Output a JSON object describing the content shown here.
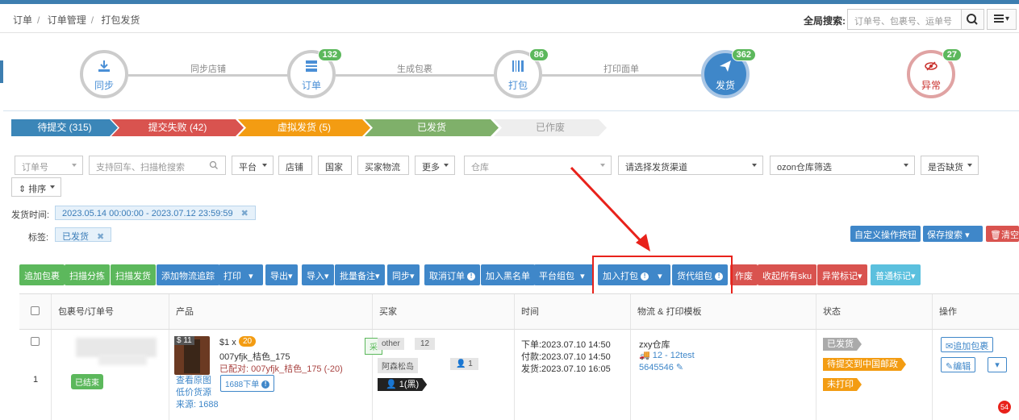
{
  "breadcrumb": [
    "订单",
    "订单管理",
    "打包发货"
  ],
  "search": {
    "label": "全局搜索:",
    "placeholder": "订单号、包裹号、运单号"
  },
  "flow": {
    "nodes": [
      {
        "label": "同步",
        "badge": ""
      },
      {
        "label": "订单",
        "badge": "132"
      },
      {
        "label": "打包",
        "badge": "86"
      },
      {
        "label": "发货",
        "badge": "362"
      },
      {
        "label": "异常",
        "badge": "27"
      }
    ],
    "links": [
      "同步店铺",
      "生成包裹",
      "打印面单"
    ]
  },
  "status_tabs": [
    "待提交 (315)",
    "提交失败 (42)",
    "虚拟发货 (5)",
    "已发货",
    "已作废"
  ],
  "filters": {
    "order_no": "订单号",
    "search_placeholder": "支持回车、扫描枪搜索",
    "platform": "平台",
    "shop": "店铺",
    "country": "国家",
    "buyer_logistics": "买家物流",
    "more": "更多",
    "warehouse": "仓库",
    "channel": "请选择发货渠道",
    "ozon": "ozon仓库筛选",
    "stock": "是否缺货",
    "sort": "排序"
  },
  "ship_time": {
    "label": "发货时间:",
    "value": "2023.05.14 00:00:00 - 2023.07.12 23:59:59"
  },
  "tag": {
    "label": "标签:",
    "value": "已发货"
  },
  "right_buttons": {
    "custom": "自定义操作按钮",
    "save": "保存搜索",
    "clear": "清空"
  },
  "toolbar": [
    "追加包裹",
    "扫描分拣",
    "扫描发货",
    "添加物流追踪",
    "打印",
    "导出",
    "导入",
    "批量备注",
    "同步",
    "取消订单",
    "加入黑名单",
    "平台组包",
    "加入打包",
    "货代组包",
    "作废",
    "收起所有sku",
    "异常标记",
    "普通标记"
  ],
  "table": {
    "headers": [
      "包裹号/订单号",
      "产品",
      "买家",
      "时间",
      "物流 & 打印模板",
      "状态",
      "操作"
    ],
    "row": {
      "index": "1",
      "finished": "已结束",
      "price": "$ 11",
      "qty": "$1 x",
      "qty_badge": "20",
      "sku": "007yfjk_桔色_175",
      "matched": "已配对: 007yfjk_桔色_175 (-20)",
      "purchase_tag": "采",
      "links": [
        "查看原图",
        "低价货源",
        "来源: 1688"
      ],
      "order_1688": "1688下单",
      "buyer_tags": [
        "other",
        "12",
        "阿森松岛",
        "1"
      ],
      "buyer_black": "1(黑)",
      "times": [
        "下单:2023.07.10 14:50",
        "付款:2023.07.10 14:50",
        "发货:2023.07.10 16:05"
      ],
      "warehouse": "zxy仓库",
      "logistics": "12 - 12test",
      "tracking": "5645546",
      "status_tags": [
        "已发货",
        "待提交到中国邮政",
        "未打印"
      ],
      "ops": [
        "追加包裹",
        "编辑"
      ]
    }
  },
  "corner_badge": "54"
}
